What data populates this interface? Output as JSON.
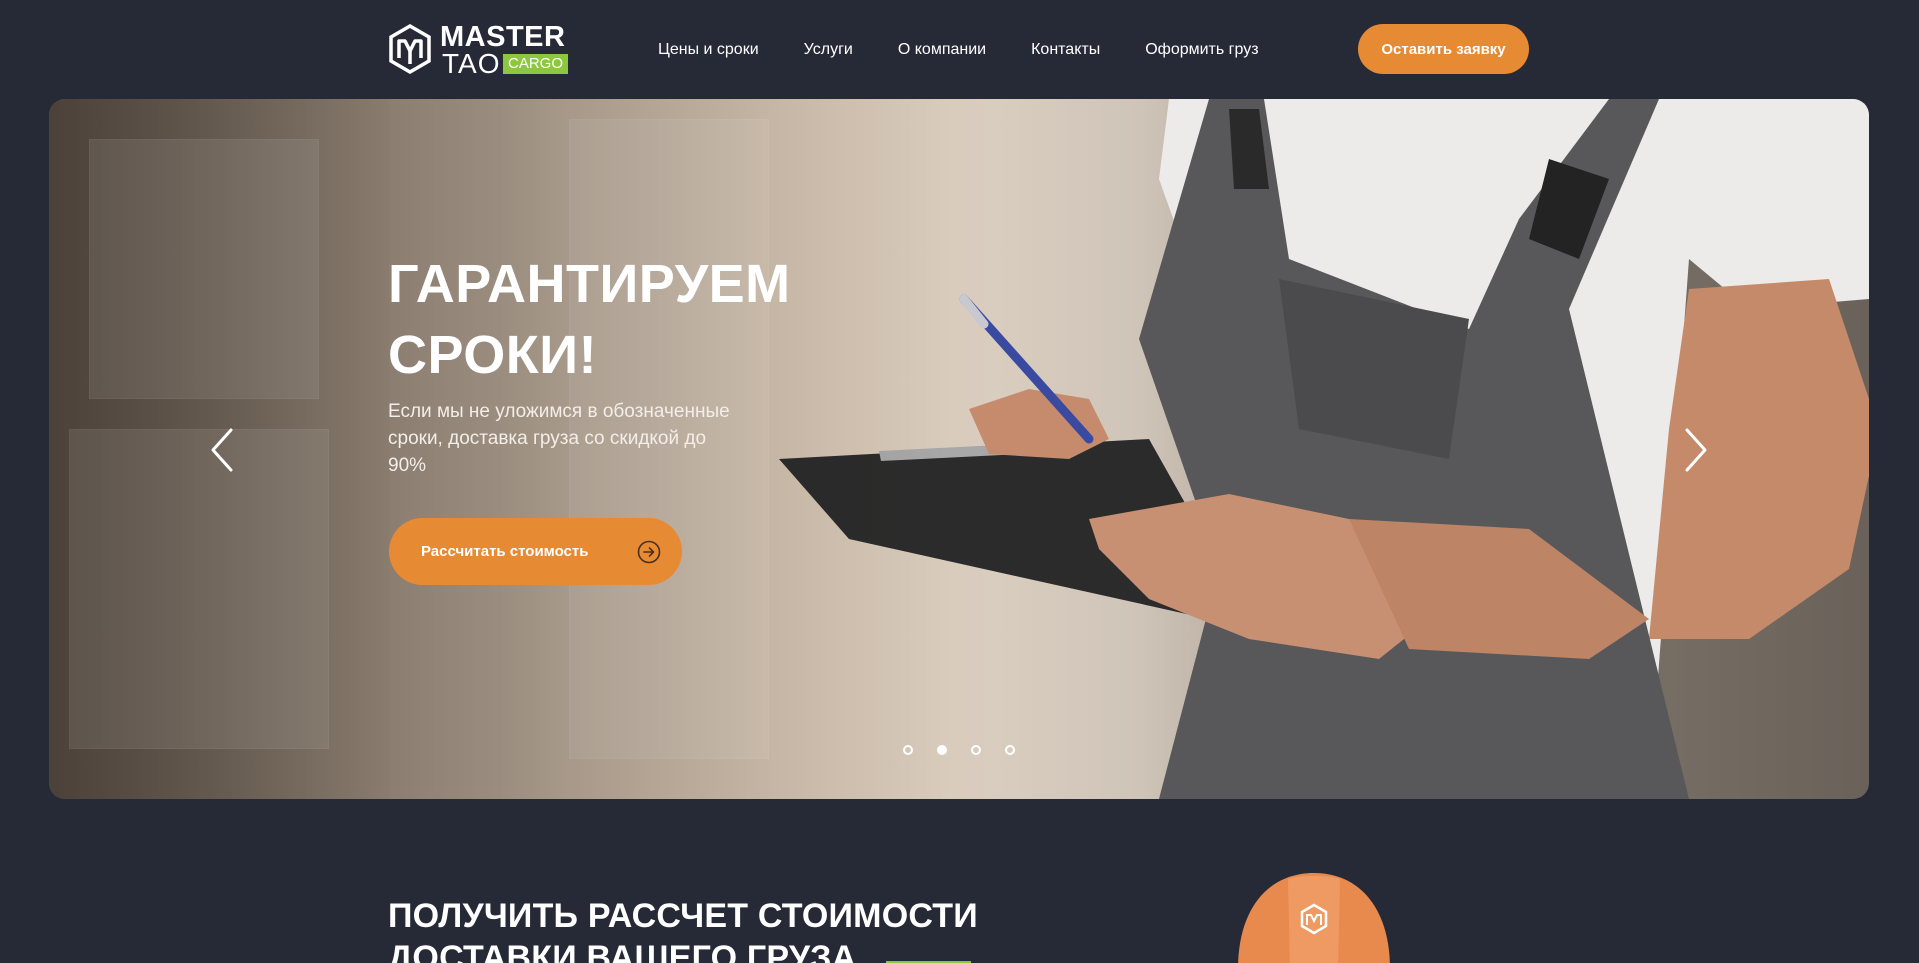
{
  "header": {
    "logo": {
      "master": "MASTER",
      "tao": "TAO",
      "cargo": "CARGO"
    },
    "nav": [
      {
        "label": "Цены и сроки"
      },
      {
        "label": "Услуги"
      },
      {
        "label": "О компании"
      },
      {
        "label": "Контакты"
      },
      {
        "label": "Оформить груз"
      }
    ],
    "cta_label": "Оставить заявку"
  },
  "hero": {
    "title_line1": "ГАРАНТИРУЕМ",
    "title_line2": "СРОКИ!",
    "subtitle": "Если мы не уложимся в обозначенные сроки, доставка груза со скидкой до 90%",
    "button_label": "Рассчитать стоимость",
    "slides_total": 4,
    "active_slide": 2
  },
  "calc_section": {
    "title_line1": "ПОЛУЧИТЬ РАССЧЕТ СТОИМОСТИ",
    "title_line2": "ДОСТАВКИ ВАШЕГО ГРУЗА"
  },
  "colors": {
    "background": "#262a37",
    "accent_orange": "#e68a34",
    "accent_green": "#8dc63f",
    "text": "#ffffff"
  },
  "icons": [
    "logo-mark-icon",
    "arrow-circle-right-icon",
    "chevron-left-icon",
    "chevron-right-icon",
    "helmet-icon"
  ]
}
